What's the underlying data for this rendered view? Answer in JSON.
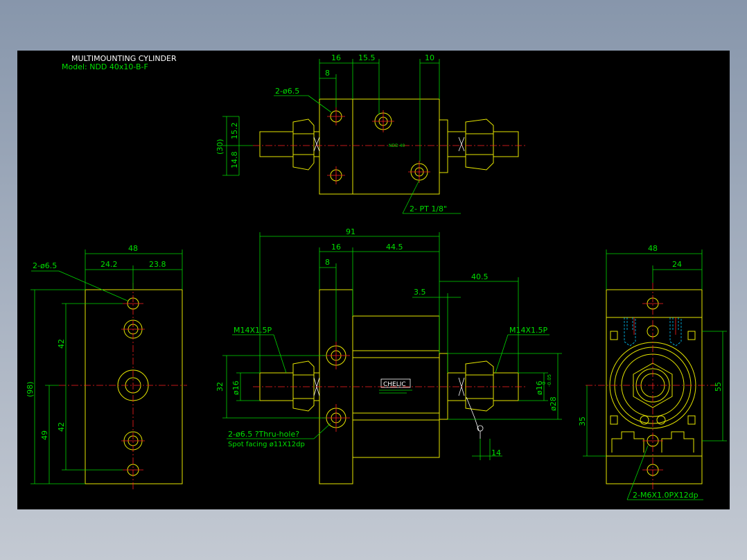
{
  "title": "MULTIMOUNTING CYLINDER",
  "model": "Model: NDD 40x10-B-F",
  "top_view": {
    "dims": [
      "16",
      "15.5",
      "10",
      "8",
      "(30)",
      "15.2",
      "14.8"
    ],
    "hole_label": "2-ø6.5",
    "port_label": "2- PT 1/8\"",
    "body_mark": "NDD 40"
  },
  "front_view": {
    "dims": [
      "91",
      "16",
      "44.5",
      "8",
      "40.5",
      "3.5",
      "32",
      "ø16",
      "ø16",
      "14"
    ],
    "rod_dim": "ø28",
    "rod_tol": "-0.05",
    "rod_tol2": "0",
    "thread_left": "M14X1.5P",
    "thread_right": "M14X1.5P",
    "hole_note_1": "2-ø6.5 ?Thru-hole?",
    "hole_note_2": "Spot facing ø11X12dp",
    "logo": "CHELIC"
  },
  "left_view": {
    "dims": [
      "48",
      "24.2",
      "23.8",
      "(98)",
      "42",
      "42",
      "49"
    ],
    "hole_label": "2-ø6.5"
  },
  "right_view": {
    "dims": [
      "48",
      "24",
      "55",
      "35"
    ],
    "thread_label": "2-M6X1.0PX12dp"
  },
  "colors": {
    "background": "#000000",
    "outline": "#e6e600",
    "dimension": "#00d800",
    "centerline": "#ff2020",
    "hidden": "#00c8ff"
  }
}
